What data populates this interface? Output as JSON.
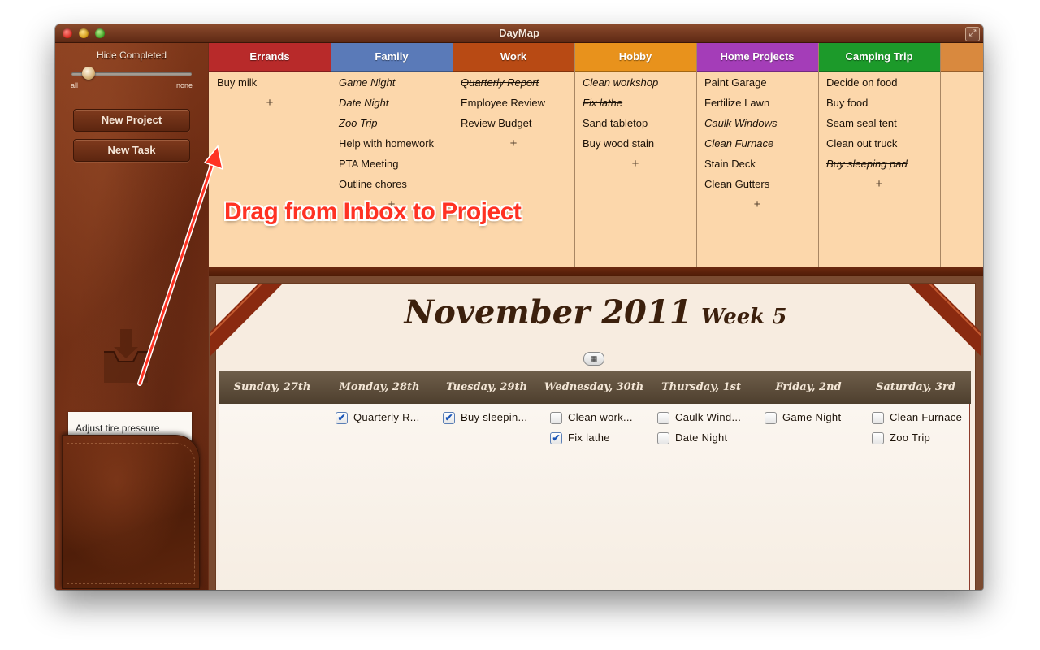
{
  "window": {
    "title": "DayMap",
    "fullscreen_icon": "fullscreen-icon"
  },
  "sidebar": {
    "hide_completed_label": "Hide Completed",
    "slider": {
      "min_label": "all",
      "max_label": "none",
      "value_fraction": 0.14
    },
    "new_project_label": "New Project",
    "new_task_label": "New Task",
    "inbox_icon": "inbox-tray-icon",
    "inbox_items": [
      "Adjust tire pressure"
    ]
  },
  "annotation": {
    "text": "Drag from Inbox to Project",
    "color": "#ff3223"
  },
  "projects": [
    {
      "name": "Errands",
      "color": "#b82a2a",
      "tasks": [
        {
          "label": "Buy milk",
          "style": "normal"
        }
      ]
    },
    {
      "name": "Family",
      "color": "#5a7ab8",
      "tasks": [
        {
          "label": "Game Night",
          "style": "italic"
        },
        {
          "label": "Date Night",
          "style": "italic"
        },
        {
          "label": "Zoo Trip",
          "style": "italic"
        },
        {
          "label": "Help with homework",
          "style": "normal"
        },
        {
          "label": "PTA Meeting",
          "style": "normal"
        },
        {
          "label": "Outline chores",
          "style": "normal"
        }
      ]
    },
    {
      "name": "Work",
      "color": "#b84a14",
      "tasks": [
        {
          "label": "Quarterly Report",
          "style": "done"
        },
        {
          "label": "Employee Review",
          "style": "normal"
        },
        {
          "label": "Review Budget",
          "style": "normal"
        }
      ]
    },
    {
      "name": "Hobby",
      "color": "#e8921c",
      "tasks": [
        {
          "label": "Clean workshop",
          "style": "italic"
        },
        {
          "label": "Fix lathe",
          "style": "done"
        },
        {
          "label": "Sand tabletop",
          "style": "normal"
        },
        {
          "label": "Buy wood stain",
          "style": "normal"
        }
      ]
    },
    {
      "name": "Home Projects",
      "color": "#a43db8",
      "tasks": [
        {
          "label": "Paint Garage",
          "style": "normal"
        },
        {
          "label": "Fertilize Lawn",
          "style": "normal"
        },
        {
          "label": "Caulk Windows",
          "style": "italic"
        },
        {
          "label": "Clean Furnace",
          "style": "italic"
        },
        {
          "label": "Stain Deck",
          "style": "normal"
        },
        {
          "label": "Clean Gutters",
          "style": "normal"
        }
      ]
    },
    {
      "name": "Camping Trip",
      "color": "#1c9a2a",
      "tasks": [
        {
          "label": "Decide on food",
          "style": "normal"
        },
        {
          "label": "Buy food",
          "style": "normal"
        },
        {
          "label": "Seam seal tent",
          "style": "normal"
        },
        {
          "label": "Clean out truck",
          "style": "normal"
        },
        {
          "label": "Buy sleeping pad",
          "style": "done"
        }
      ]
    },
    {
      "name": "",
      "color": "#d9893e",
      "tasks": []
    }
  ],
  "add_task_symbol": "+",
  "calendar": {
    "month_title": "November 2011",
    "week_label": "Week 5",
    "toggle_icon": "grid-icon",
    "days": [
      {
        "header": "Sunday, 27th",
        "tasks": []
      },
      {
        "header": "Monday, 28th",
        "tasks": [
          {
            "label": "Quarterly R...",
            "checked": true
          }
        ]
      },
      {
        "header": "Tuesday, 29th",
        "tasks": [
          {
            "label": "Buy sleepin...",
            "checked": true
          }
        ]
      },
      {
        "header": "Wednesday, 30th",
        "tasks": [
          {
            "label": "Clean work...",
            "checked": false
          },
          {
            "label": "Fix lathe",
            "checked": true
          }
        ]
      },
      {
        "header": "Thursday, 1st",
        "tasks": [
          {
            "label": "Caulk Wind...",
            "checked": false
          },
          {
            "label": "Date Night",
            "checked": false
          }
        ]
      },
      {
        "header": "Friday, 2nd",
        "tasks": [
          {
            "label": "Game Night",
            "checked": false
          }
        ]
      },
      {
        "header": "Saturday, 3rd",
        "tasks": [
          {
            "label": "Clean Furnace",
            "checked": false
          },
          {
            "label": "Zoo Trip",
            "checked": false
          }
        ]
      }
    ]
  },
  "checkmark_glyph": "✔"
}
